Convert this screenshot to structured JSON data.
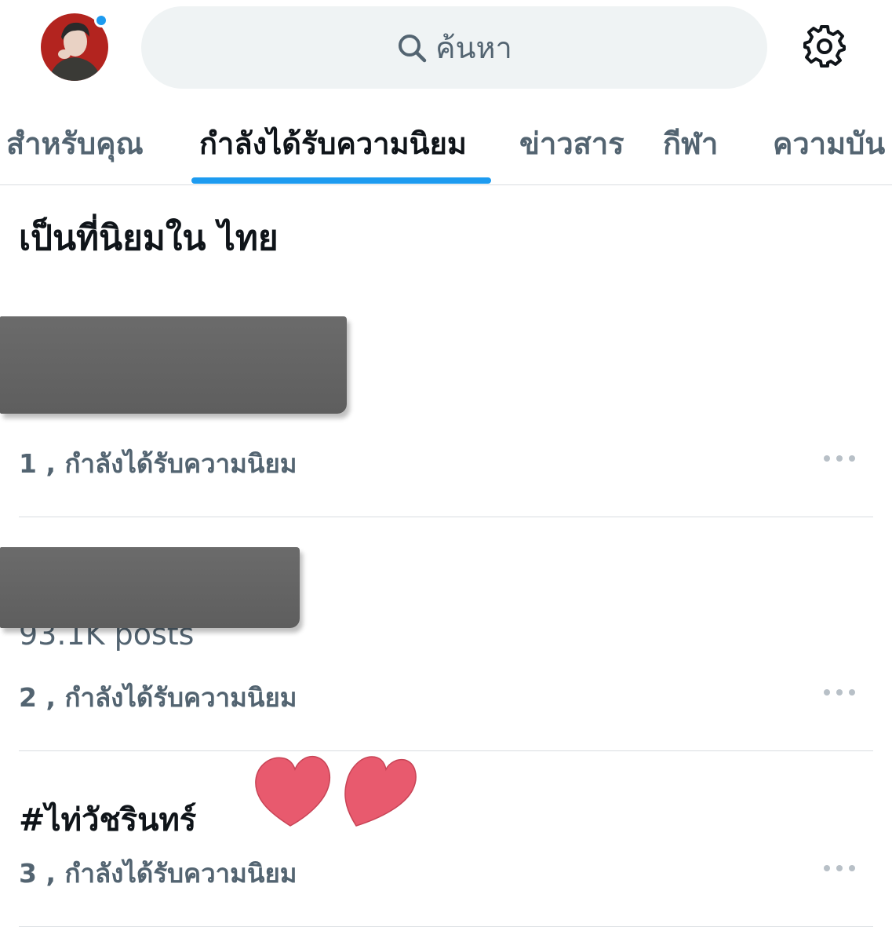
{
  "search": {
    "placeholder": "ค้นหา"
  },
  "tabs": [
    {
      "label": "สำหรับคุณ",
      "active": false
    },
    {
      "label": "กำลังได้รับความนิยม",
      "active": true
    },
    {
      "label": "ข่าวสาร",
      "active": false
    },
    {
      "label": "กีฬา",
      "active": false
    },
    {
      "label": "ความบัน",
      "active": false
    }
  ],
  "section": {
    "title": "เป็นที่นิยมใน ไทย"
  },
  "trends": [
    {
      "rank_label": "1",
      "meta": "1 , กำลังได้รับความนิยม",
      "name_redacted": true
    },
    {
      "rank_label": "2",
      "meta": "2 , กำลังได้รับความนิยม",
      "name_redacted": true,
      "posts": "93.1K posts"
    },
    {
      "rank_label": "3",
      "meta": "3 , กำลังได้รับความนิยม",
      "name": "#ไท่วัชรินทร์"
    }
  ],
  "colors": {
    "accent": "#1d9bf0",
    "text_primary": "#0f1419",
    "text_secondary": "#536471",
    "heart": "#e85a6e"
  },
  "icons": {
    "search": "search-icon",
    "settings": "gear-icon",
    "more": "more-horizontal-icon",
    "heart": "heart-icon"
  }
}
